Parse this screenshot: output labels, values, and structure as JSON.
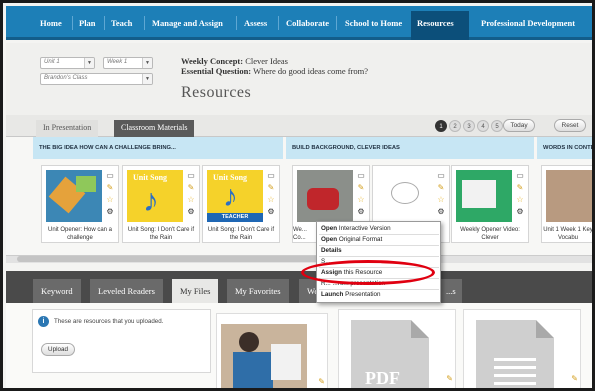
{
  "nav": {
    "items": [
      "Home",
      "Plan",
      "Teach",
      "Manage and Assign",
      "Assess",
      "Collaborate",
      "School to Home",
      "Resources",
      "Professional Development"
    ],
    "active": "Resources"
  },
  "header": {
    "unit_select": "Unit 1",
    "week_select": "Week 1",
    "class_select": "Brandon's Class",
    "concept_label": "Weekly Concept:",
    "concept_value": "Clever Ideas",
    "question_label": "Essential Question:",
    "question_value": "Where do good ideas come from?",
    "page_title": "Resources"
  },
  "tabs": {
    "in_presentation": "In Presentation",
    "classroom_materials": "Classroom Materials",
    "pages": [
      "1",
      "2",
      "3",
      "4",
      "5"
    ],
    "active_page": "1",
    "today": "Today",
    "reset": "Reset"
  },
  "sections": [
    "THE BIG IDEA HOW CAN A CHALLENGE BRING...",
    "BUILD BACKGROUND, CLEVER IDEAS",
    "WORDS IN CONTE"
  ],
  "cards": [
    {
      "label": "Unit Opener: How can a challenge"
    },
    {
      "label": "Unit Song: I Don't Care if the Rain",
      "thumb_text": "Unit Song"
    },
    {
      "label": "Unit Song: I Don't Care if the Rain",
      "thumb_text": "Unit Song",
      "badge": "TEACHER"
    },
    {
      "label": "We... Co..."
    },
    {
      "label": ""
    },
    {
      "label": "Weekly Opener Video: Clever"
    },
    {
      "label": "Unit 1 Week 1 Key Vocabu"
    }
  ],
  "context_menu": {
    "items": [
      {
        "bold": "Open",
        "rest": " Interactive Version"
      },
      {
        "bold": "Open",
        "rest": " Original Format"
      },
      {
        "bold": "Details",
        "rest": ""
      },
      {
        "bold": "",
        "rest": "S..."
      },
      {
        "bold": "Assign",
        "rest": " this Resource"
      },
      {
        "bold": "",
        "rest": "R... ...rom presentation"
      },
      {
        "bold": "Launch",
        "rest": " Presentation"
      }
    ]
  },
  "lower_tabs": [
    "Keyword",
    "Leveled Readers",
    "My Files",
    "My Favorites",
    "We...",
    "...s"
  ],
  "lower_active": "My Files",
  "info_text": "These are resources that you uploaded.",
  "upload_label": "Upload",
  "pdf_label": "PDF",
  "colors": {
    "nav": "#1d7fb7",
    "section": "#c7e6f4",
    "highlight_ring": "#e00010"
  }
}
